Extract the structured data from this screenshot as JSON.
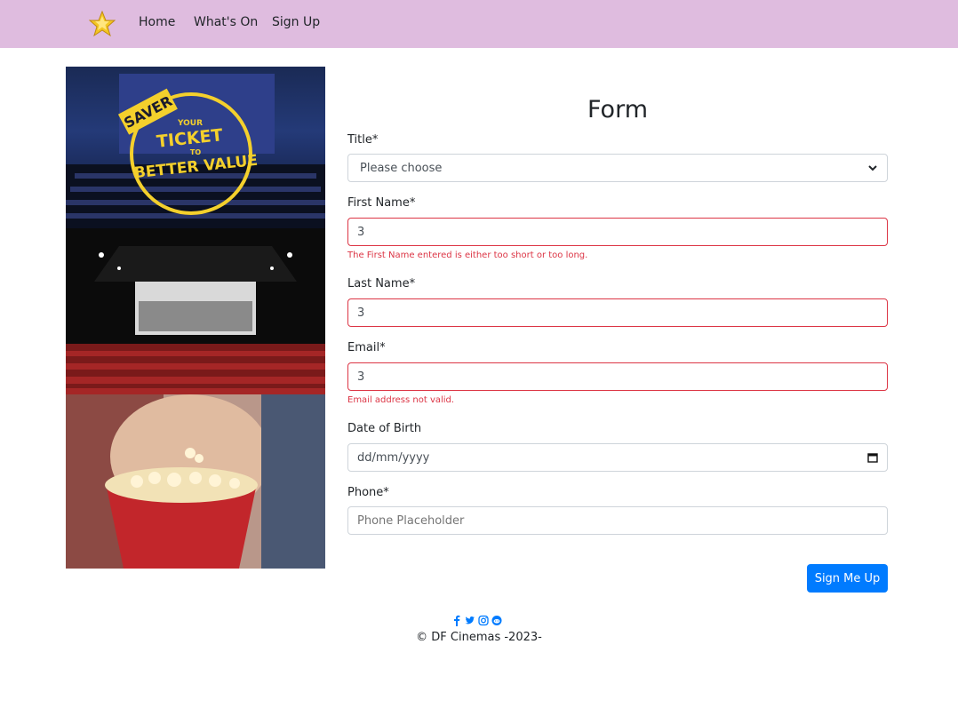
{
  "nav": {
    "home": "Home",
    "whats_on": "What's On",
    "sign_up": "Sign Up"
  },
  "images": {
    "saver_badge": "SAVER",
    "ticket_text": "TICKET",
    "your_text": "YOUR",
    "to_text": "TO",
    "value_text": "BETTER VALUE"
  },
  "form": {
    "title": "Form",
    "title_label": "Title*",
    "title_value": "Please choose",
    "first_name_label": "First Name*",
    "first_name_value": "3",
    "first_name_error": "The First Name entered is either too short or too long.",
    "last_name_label": "Last Name*",
    "last_name_value": "3",
    "email_label": "Email*",
    "email_value": "3",
    "email_error": "Email address not valid.",
    "dob_label": "Date of Birth",
    "dob_placeholder": "dd/mm/yyyy",
    "phone_label": "Phone*",
    "phone_placeholder": "Phone Placeholder",
    "submit_label": "Sign Me Up"
  },
  "footer": {
    "copyright": "© DF Cinemas -2023-"
  },
  "colors": {
    "navbar": "#dfbcdf",
    "primary": "#007bff",
    "error": "#dc3545"
  },
  "icons": [
    "star-logo-icon",
    "facebook-icon",
    "twitter-icon",
    "instagram-icon",
    "reddit-icon",
    "calendar-icon",
    "chevron-down-icon"
  ]
}
